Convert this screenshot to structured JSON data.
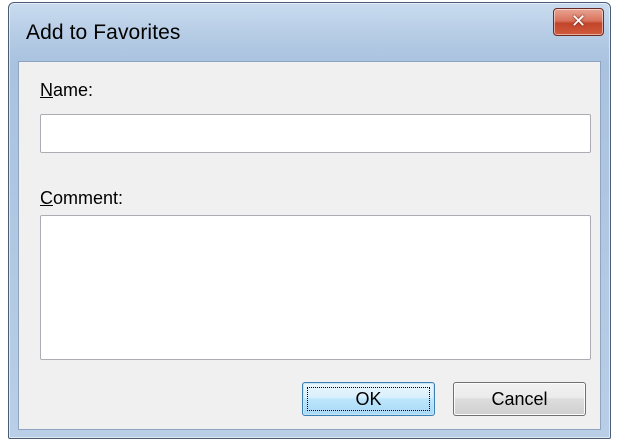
{
  "window": {
    "title": "Add to Favorites",
    "close_icon": "close-icon"
  },
  "form": {
    "name": {
      "label_accel": "N",
      "label_rest": "ame:",
      "value": ""
    },
    "comment": {
      "label_accel": "C",
      "label_rest": "omment:",
      "value": ""
    }
  },
  "buttons": {
    "ok_label": "OK",
    "cancel_label": "Cancel"
  },
  "colors": {
    "titlebar": "#b7cde6",
    "client_bg": "#f0f0f0",
    "close_button": "#c2452b",
    "default_button": "#bee6fd"
  }
}
